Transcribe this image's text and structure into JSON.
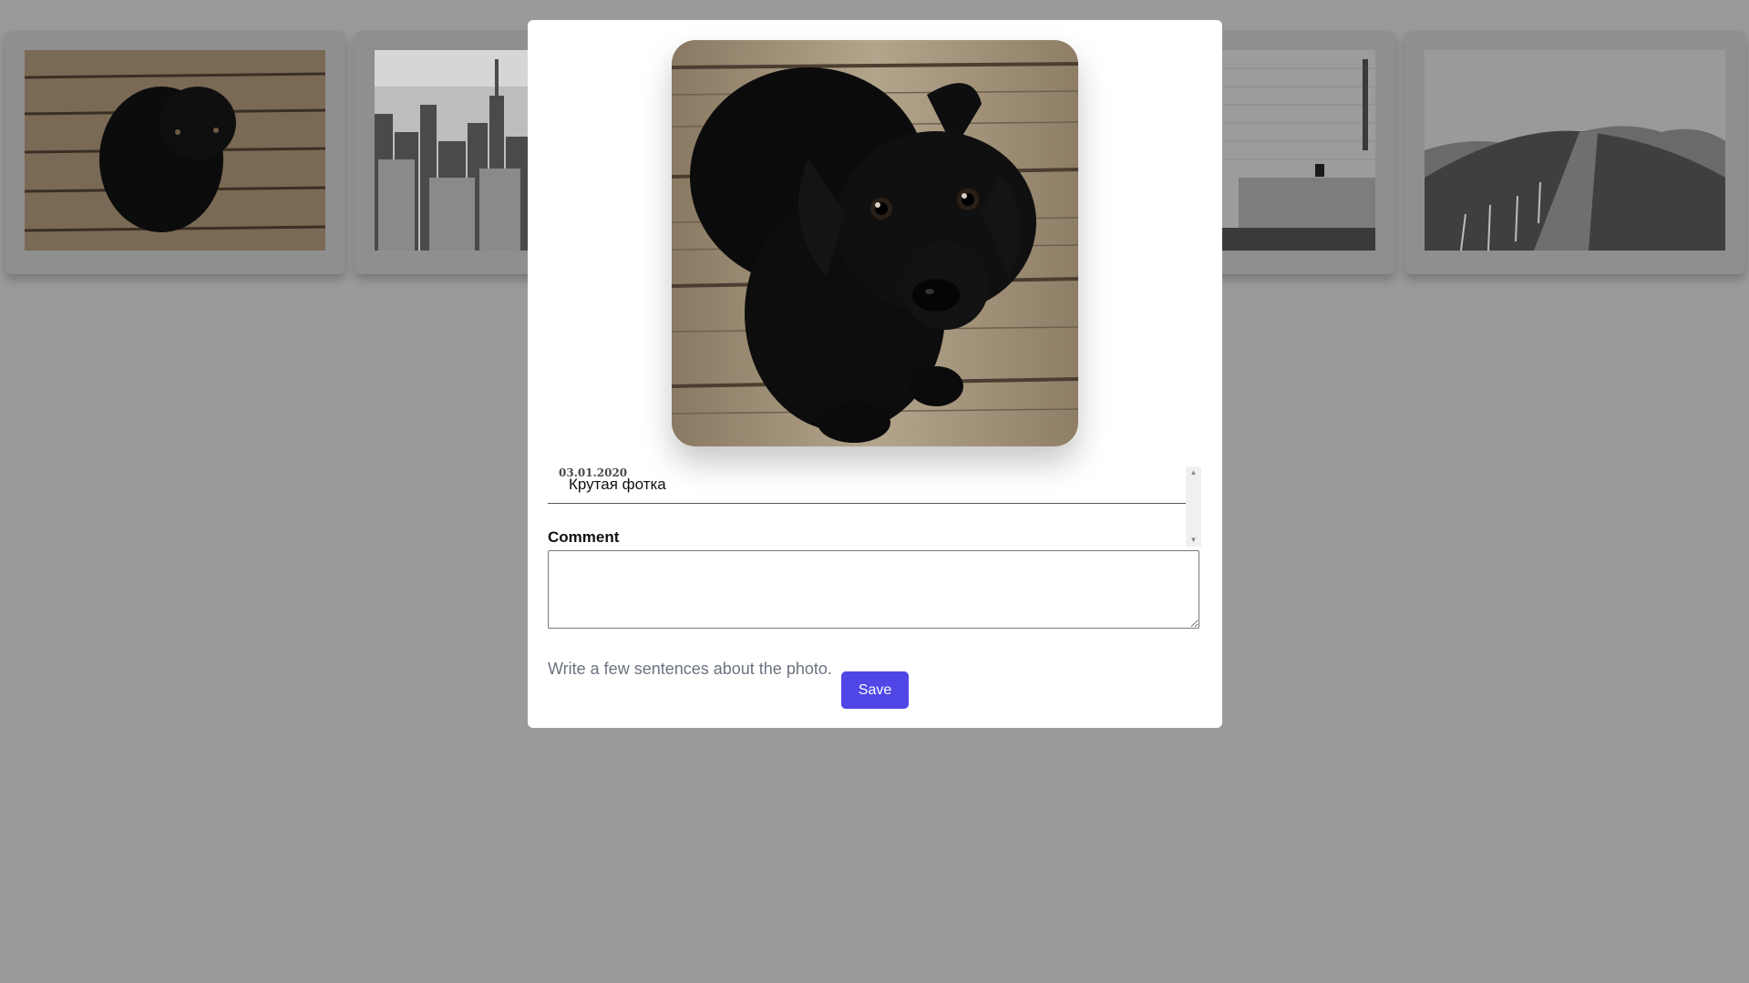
{
  "gallery": {
    "cards": [
      {
        "name": "card-dog",
        "thumb_icon": "puppy-photo"
      },
      {
        "name": "card-city",
        "thumb_icon": "city-skyline-photo"
      },
      {
        "name": "card-hidden-1",
        "thumb_icon": "photo"
      },
      {
        "name": "card-stairs",
        "thumb_icon": "stairs-photo"
      },
      {
        "name": "card-hills",
        "thumb_icon": "hills-photo"
      }
    ]
  },
  "modal": {
    "photo_icon": "puppy-photo",
    "comments": [
      {
        "date": "03.01.2020",
        "text": "Крутая фотка"
      }
    ],
    "comment_label": "Comment",
    "comment_value": "",
    "help_text": "Write a few sentences about the photo.",
    "save_label": "Save"
  },
  "colors": {
    "backdrop": "#9a9a9a",
    "accent": "#4f46e5",
    "help_text": "#6b7280"
  }
}
